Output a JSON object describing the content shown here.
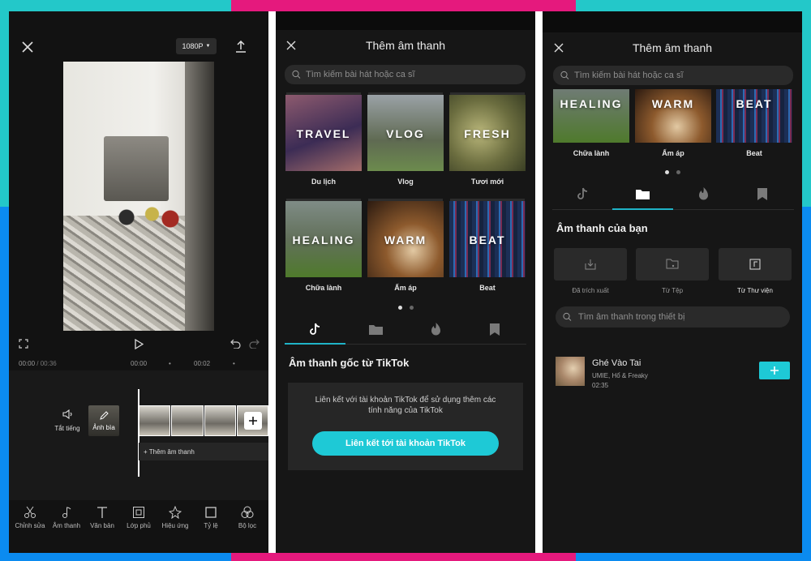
{
  "colors": {
    "accent": "#1ec9d6",
    "teal_bg": "#23c8c9",
    "pink_bg": "#e5197d",
    "blue_bg": "#0b8bf0",
    "panel": "#161616"
  },
  "editor": {
    "resolution": "1080P",
    "current_time": "00:00",
    "total_time": "/ 00:36",
    "ruler_marks": [
      "00:00",
      "00:02"
    ],
    "mute_label": "Tắt tiếng",
    "cover_label": "Ảnh bìa",
    "add_audio_label": "+ Thêm âm thanh",
    "toolbar": [
      "Chỉnh sửa",
      "Âm thanh",
      "Văn bản",
      "Lớp phủ",
      "Hiệu ứng",
      "Tỷ lệ",
      "Bộ lọc"
    ]
  },
  "add_sound": {
    "title": "Thêm âm thanh",
    "search_placeholder": "Tìm kiếm bài hát hoặc ca sĩ",
    "categories": [
      {
        "badge": "TRAVEL",
        "name": "Du lịch"
      },
      {
        "badge": "VLOG",
        "name": "Vlog"
      },
      {
        "badge": "FRESH",
        "name": "Tươi mới"
      },
      {
        "badge": "HEALING",
        "name": "Chữa lành"
      },
      {
        "badge": "WARM",
        "name": "Ấm áp"
      },
      {
        "badge": "BEAT",
        "name": "Beat"
      }
    ],
    "tabs": [
      "tiktok-icon",
      "folder-icon",
      "fire-icon",
      "bookmark-icon"
    ],
    "tiktok_section": {
      "title": "Âm thanh gốc từ TikTok",
      "message": "Liên kết với tài khoản TikTok để sử dụng thêm các tính năng của TikTok",
      "button": "Liên kết tới tài khoản TikTok"
    }
  },
  "your_sounds": {
    "title": "Thêm âm thanh",
    "search_placeholder": "Tìm kiếm bài hát hoặc ca sĩ",
    "section_title": "Âm thanh của bạn",
    "sources": [
      "Đã trích xuất",
      "Từ Tệp",
      "Từ Thư viện"
    ],
    "device_search_placeholder": "Tìm âm thanh trong thiết bị",
    "song": {
      "title": "Ghé Vào Tai",
      "artist": "UMIE, Hổ & Freaky",
      "duration": "02:35"
    }
  }
}
